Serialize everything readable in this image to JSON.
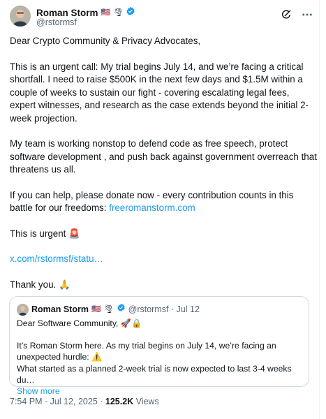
{
  "tweet": {
    "author_name": "Roman Storm",
    "author_handle": "@rstormsf",
    "flag_emoji": "🇺🇸",
    "tornado_emoji": "🌪",
    "lines": [
      "Dear Crypto Community & Privacy Advocates,",
      "This is an urgent call: My trial begins July 14, and we’re facing a critical shortfall. I need to raise $500K in the next few days and $1.5M within a couple of weeks to sustain our fight - covering escalating legal fees, expert witnesses, and research as the case extends beyond the initial 2-week projection.",
      "My team is working nonstop to defend code as free speech, protect software development , and push back against government overreach that threatens us all.",
      "If you can help, please donate now - every contribution counts in this battle for our freedoms: "
    ],
    "donate_link": "freeromanstorm.com",
    "urgent_text": "This is urgent ",
    "urgent_emoji": "🚨",
    "status_link": "x.com/rstormsf/statu…",
    "thanks_text": "Thank you. ",
    "thanks_emoji": "🙏"
  },
  "quote": {
    "author_name": "Roman Storm",
    "flag_emoji": "🇺🇸",
    "tornado_emoji": "🌪",
    "handle_date": "@rstormsf · Jul 12",
    "line1": "Dear Software Community, 🚀🔒",
    "line2": "It’s Roman Storm here. As my trial begins on July 14, we’re facing an unexpected hurdle: ⚠️",
    "line3": "What started as a planned 2-week trial is now expected to last 3-4 weeks du…",
    "show_more": "Show more"
  },
  "meta": {
    "time_date": "7:54 PM · Jul 12, 2025 · ",
    "views_count": "125.2K",
    "views_label": " Views"
  },
  "colors": {
    "link": "#1d9bf0",
    "verified": "#1d9bf0",
    "muted": "#536471"
  }
}
